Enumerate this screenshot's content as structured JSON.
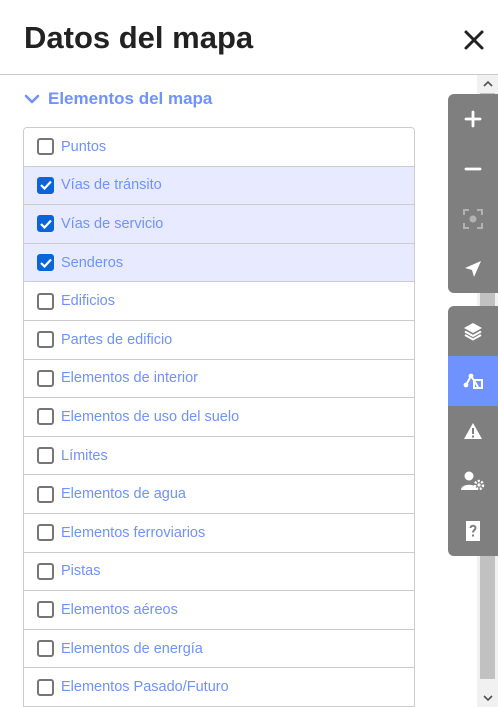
{
  "header": {
    "title": "Datos del mapa"
  },
  "section": {
    "label": "Elementos del mapa",
    "expanded": true
  },
  "features": [
    {
      "label": "Puntos",
      "checked": false
    },
    {
      "label": "Vías de tránsito",
      "checked": true
    },
    {
      "label": "Vías de servicio",
      "checked": true
    },
    {
      "label": "Senderos",
      "checked": true
    },
    {
      "label": "Edificios",
      "checked": false
    },
    {
      "label": "Partes de edificio",
      "checked": false
    },
    {
      "label": "Elementos de interior",
      "checked": false
    },
    {
      "label": "Elementos de uso del suelo",
      "checked": false
    },
    {
      "label": "Límites",
      "checked": false
    },
    {
      "label": "Elementos de agua",
      "checked": false
    },
    {
      "label": "Elementos ferroviarios",
      "checked": false
    },
    {
      "label": "Pistas",
      "checked": false
    },
    {
      "label": "Elementos aéreos",
      "checked": false
    },
    {
      "label": "Elementos de energía",
      "checked": false
    },
    {
      "label": "Elementos Pasado/Futuro",
      "checked": false
    }
  ],
  "map_controls": {
    "group1": [
      "zoom-in-icon",
      "zoom-out-icon",
      "zoom-to-selection-icon",
      "geolocate-icon"
    ],
    "group2": [
      "layers-icon",
      "map-data-icon",
      "issues-icon",
      "preferences-icon",
      "help-icon"
    ],
    "active": "map-data-icon"
  },
  "colors": {
    "accent": "#7092ff",
    "checkbox_checked": "#0a66d8",
    "row_active": "#e8ebff",
    "controls_bg": "#7f7f7f"
  }
}
